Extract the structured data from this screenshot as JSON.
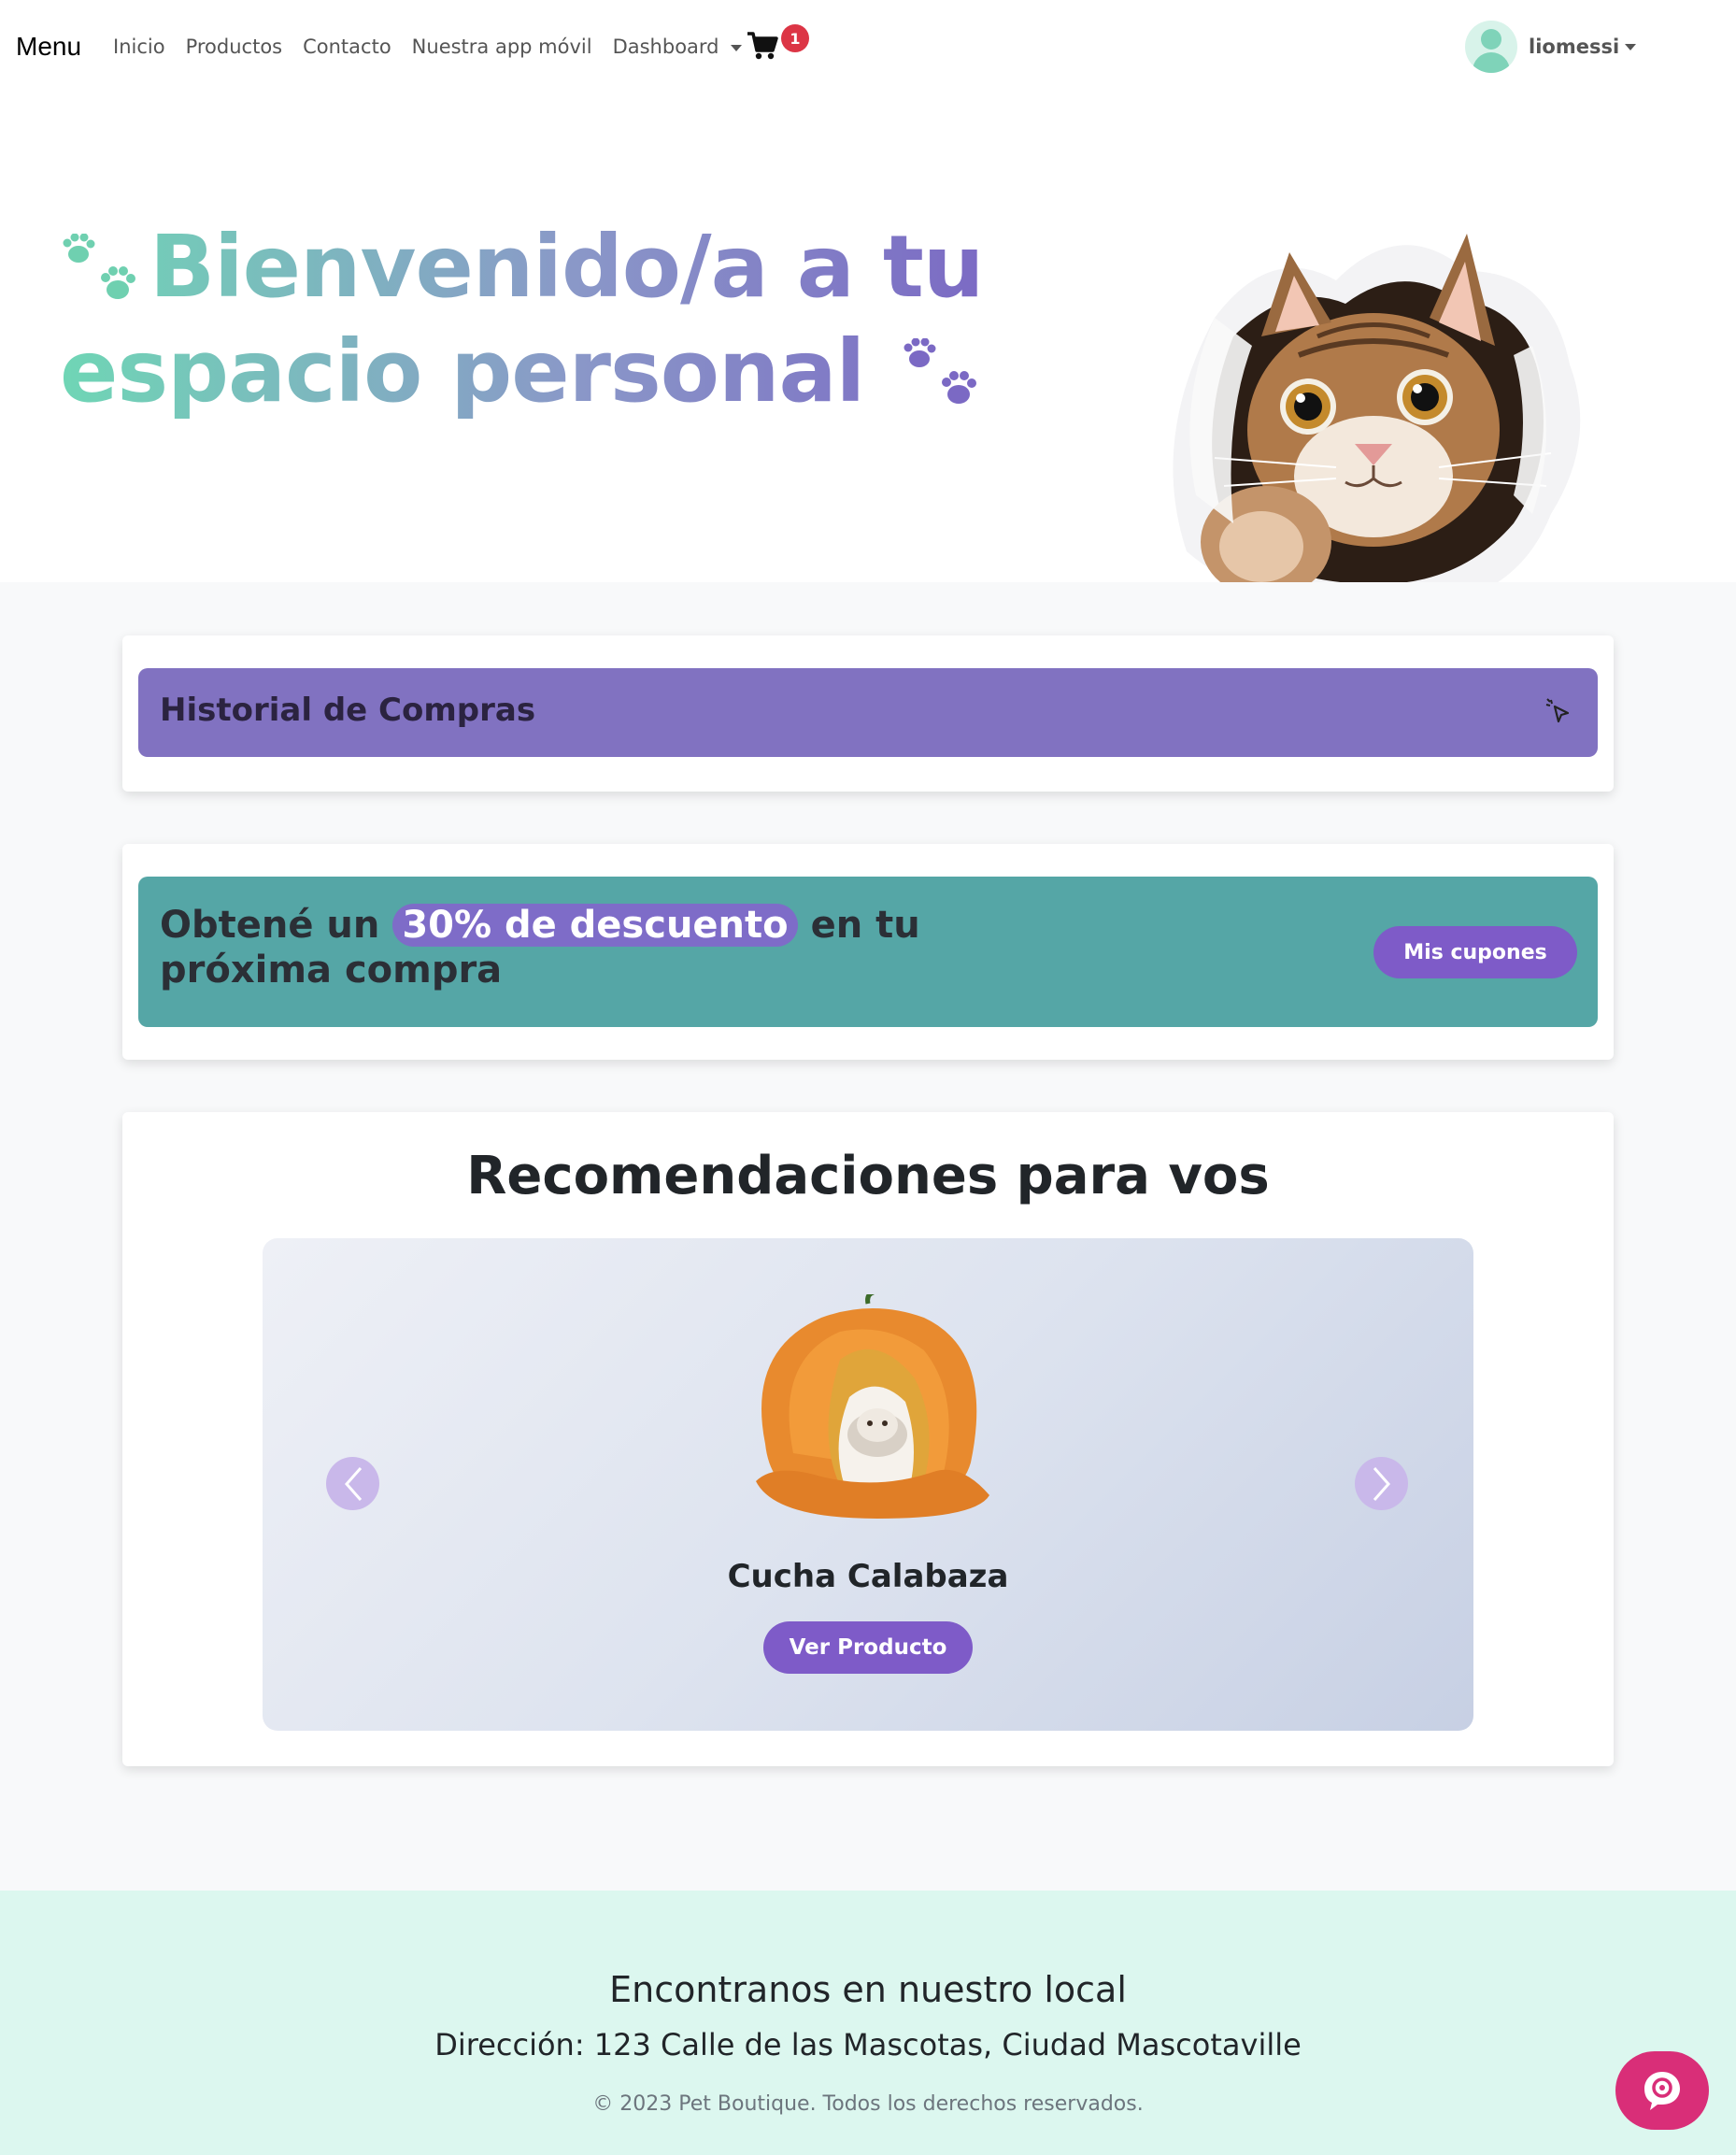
{
  "navbar": {
    "brand": "Menu",
    "links": [
      "Inicio",
      "Productos",
      "Contacto",
      "Nuestra app móvil",
      "Dashboard"
    ],
    "cart_icon": "shopping-cart-icon",
    "cart_count": "1",
    "username": "liomessi"
  },
  "hero": {
    "title_line1": "Bienvenido/a a tu",
    "title_line2": "espacio personal",
    "icon": "paw-icon",
    "gradient": [
      "#6fd6b5",
      "#8a98c8",
      "#7b69c4"
    ]
  },
  "history": {
    "title": "Historial de Compras",
    "icon": "click-cursor-icon",
    "color": "#8172c1"
  },
  "promo": {
    "text_before": "Obtené un",
    "highlight": "30% de descuento",
    "text_after": "en tu próxima compra",
    "button_label": "Mis cupones",
    "color": "#55a6a6"
  },
  "recommendations": {
    "title": "Recomendaciones para vos",
    "product_name": "Cucha Calabaza",
    "button_label": "Ver Producto",
    "prev_icon": "chevron-left-icon",
    "next_icon": "chevron-right-icon"
  },
  "footer": {
    "title": "Encontranos en nuestro local",
    "address": "Dirección: 123 Calle de las Mascotas, Ciudad Mascotaville",
    "copyright": "© 2023 Pet Boutique. Todos los derechos reservados.",
    "chat_icon": "chat-bubble-icon",
    "background": "#dcf7ef"
  }
}
